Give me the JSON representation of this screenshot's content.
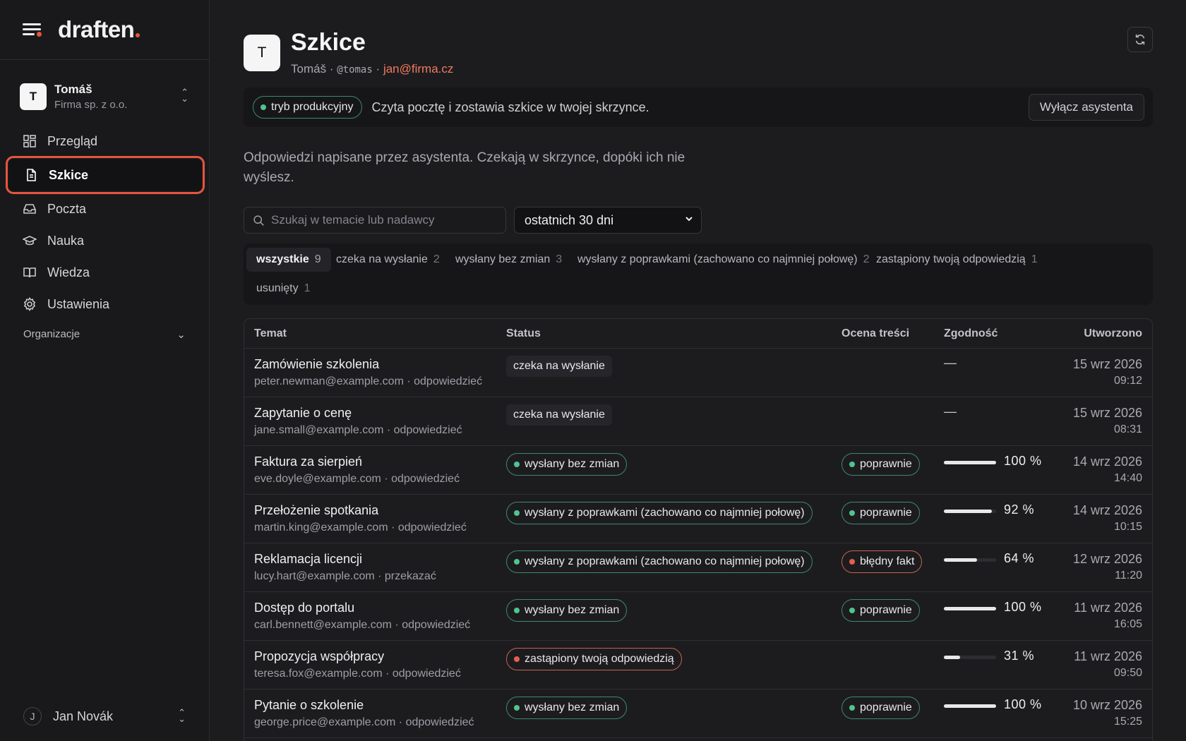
{
  "brand": {
    "name": "draften",
    "accent": "#e6553f"
  },
  "account": {
    "initial": "T",
    "name": "Tomáš",
    "org": "Firma sp. z o.o."
  },
  "nav": {
    "items": [
      {
        "label": "Przegląd",
        "icon": "dashboard-icon"
      },
      {
        "label": "Szkice",
        "icon": "document-icon",
        "active": true
      },
      {
        "label": "Poczta",
        "icon": "inbox-icon"
      },
      {
        "label": "Nauka",
        "icon": "graduation-cap-icon"
      },
      {
        "label": "Wiedza",
        "icon": "book-icon"
      },
      {
        "label": "Ustawienia",
        "icon": "gear-icon"
      }
    ],
    "organizations_label": "Organizacje"
  },
  "user": {
    "initial": "J",
    "name": "Jan Novák"
  },
  "header": {
    "avatar_initial": "T",
    "title": "Szkice",
    "owner": "Tomáš",
    "handle": "@tomas",
    "email": "jan@firma.cz",
    "separator": "·"
  },
  "banner": {
    "mode_label": "tryb produkcyjny",
    "text": "Czyta pocztę i zostawia szkice w twojej skrzynce.",
    "disable_label": "Wyłącz asystenta"
  },
  "lead": "Odpowiedzi napisane przez asystenta. Czekają w skrzynce, dopóki ich nie wyślesz.",
  "search": {
    "placeholder": "Szukaj w temacie lub nadawcy",
    "value": ""
  },
  "period": {
    "selected": "ostatnich 30 dni"
  },
  "filters": [
    {
      "label": "wszystkie",
      "count": "9",
      "active": true
    },
    {
      "label": "czeka na wysłanie",
      "count": "2"
    },
    {
      "label": "wysłany bez zmian",
      "count": "3"
    },
    {
      "label": "wysłany z poprawkami (zachowano co najmniej połowę)",
      "count": "2"
    },
    {
      "label": "zastąpiony twoją odpowiedzią",
      "count": "1"
    },
    {
      "label": "usunięty",
      "count": "1"
    }
  ],
  "table": {
    "columns": {
      "subject": "Temat",
      "status": "Status",
      "score": "Ocena treści",
      "match": "Zgodność",
      "created": "Utworzono"
    },
    "rows": [
      {
        "subject": "Zamówienie szkolenia",
        "sender": "peter.newman@example.com",
        "action": "odpowiedzieć",
        "status": "czeka na wysłanie",
        "status_kind": "plain",
        "score": "",
        "score_kind": "",
        "match": null,
        "match_text": "—",
        "date": "15 wrz 2026",
        "time": "09:12"
      },
      {
        "subject": "Zapytanie o cenę",
        "sender": "jane.small@example.com",
        "action": "odpowiedzieć",
        "status": "czeka na wysłanie",
        "status_kind": "plain",
        "score": "",
        "score_kind": "",
        "match": null,
        "match_text": "—",
        "date": "15 wrz 2026",
        "time": "08:31"
      },
      {
        "subject": "Faktura za sierpień",
        "sender": "eve.doyle@example.com",
        "action": "odpowiedzieć",
        "status": "wysłany bez zmian",
        "status_kind": "green",
        "score": "poprawnie",
        "score_kind": "green",
        "match": 100,
        "match_text": "100 %",
        "date": "14 wrz 2026",
        "time": "14:40"
      },
      {
        "subject": "Przełożenie spotkania",
        "sender": "martin.king@example.com",
        "action": "odpowiedzieć",
        "status": "wysłany z poprawkami (zachowano co najmniej połowę)",
        "status_kind": "green",
        "score": "poprawnie",
        "score_kind": "green",
        "match": 92,
        "match_text": "92 %",
        "date": "14 wrz 2026",
        "time": "10:15"
      },
      {
        "subject": "Reklamacja licencji",
        "sender": "lucy.hart@example.com",
        "action": "przekazać",
        "status": "wysłany z poprawkami (zachowano co najmniej połowę)",
        "status_kind": "green",
        "score": "błędny fakt",
        "score_kind": "red",
        "match": 64,
        "match_text": "64 %",
        "date": "12 wrz 2026",
        "time": "11:20"
      },
      {
        "subject": "Dostęp do portalu",
        "sender": "carl.bennett@example.com",
        "action": "odpowiedzieć",
        "status": "wysłany bez zmian",
        "status_kind": "green",
        "score": "poprawnie",
        "score_kind": "green",
        "match": 100,
        "match_text": "100 %",
        "date": "11 wrz 2026",
        "time": "16:05"
      },
      {
        "subject": "Propozycja współpracy",
        "sender": "teresa.fox@example.com",
        "action": "odpowiedzieć",
        "status": "zastąpiony twoją odpowiedzią",
        "status_kind": "red",
        "score": "",
        "score_kind": "",
        "match": 31,
        "match_text": "31 %",
        "date": "11 wrz 2026",
        "time": "09:50"
      },
      {
        "subject": "Pytanie o szkolenie",
        "sender": "george.price@example.com",
        "action": "odpowiedzieć",
        "status": "wysłany bez zmian",
        "status_kind": "green",
        "score": "poprawnie",
        "score_kind": "green",
        "match": 100,
        "match_text": "100 %",
        "date": "10 wrz 2026",
        "time": "15:25"
      }
    ]
  },
  "colors": {
    "green": "#4fc48f",
    "red": "#e4604c",
    "email_accent": "#f07a5e"
  }
}
